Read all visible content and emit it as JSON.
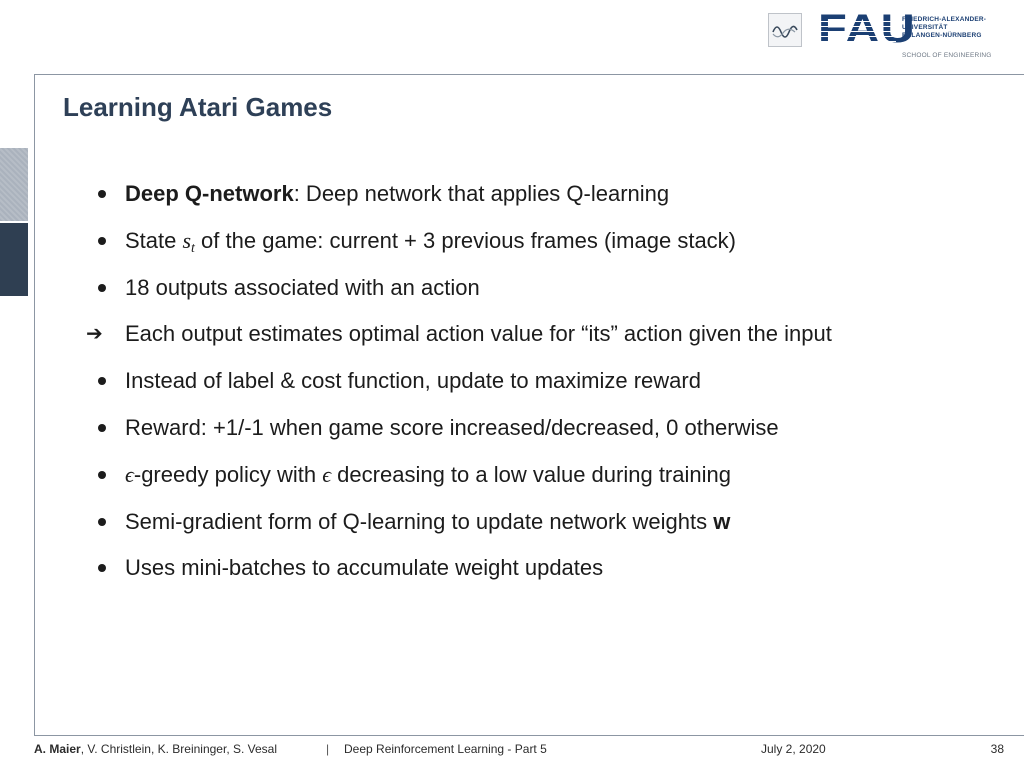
{
  "header": {
    "university_lines": [
      "FRIEDRICH-ALEXANDER-",
      "UNIVERSITÄT",
      "ERLANGEN-NÜRNBERG"
    ],
    "fau_mark": "FAU",
    "school": "SCHOOL OF ENGINEERING"
  },
  "slide": {
    "title": "Learning Atari Games",
    "bullets": [
      {
        "marker": "dot",
        "bold_lead": "Deep Q-network",
        "text": ": Deep network that applies Q-learning"
      },
      {
        "marker": "dot",
        "pre": "State ",
        "math_var": "s",
        "math_sub": "t",
        "text": " of the game: current + 3 previous frames (image stack)"
      },
      {
        "marker": "dot",
        "text": "18 outputs associated with an action"
      },
      {
        "marker": "arrow",
        "arrow_glyph": "➔",
        "text": "Each output estimates optimal action value for “its” action given the input"
      },
      {
        "marker": "dot",
        "text": "Instead of label & cost function, update to maximize reward"
      },
      {
        "marker": "dot",
        "text": "Reward: +1/-1 when game score increased/decreased, 0 otherwise"
      },
      {
        "marker": "dot",
        "eps1": "ϵ",
        "mid": "-greedy policy with ",
        "eps2": "ϵ",
        "text": " decreasing to a low value during training"
      },
      {
        "marker": "dot",
        "text": "Semi-gradient form of Q-learning to update network weights ",
        "bold_tail": "w"
      },
      {
        "marker": "dot",
        "text": "Uses mini-batches to accumulate weight updates"
      }
    ]
  },
  "footer": {
    "lead_author": "A. Maier",
    "other_authors": ", V. Christlein, K. Breininger, S. Vesal",
    "separator": "|",
    "course": "Deep Reinforcement Learning - Part 5",
    "date": "July 2, 2020",
    "page": "38"
  },
  "colors": {
    "title": "#2e4057",
    "fau_blue": "#1b3f73",
    "side_tab_dark": "#2f3f52",
    "side_tab_light": "#aab2bd"
  }
}
